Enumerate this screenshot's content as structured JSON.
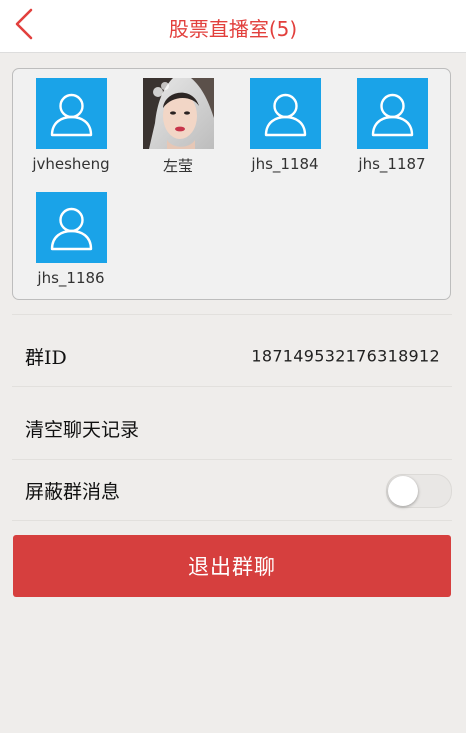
{
  "header": {
    "title": "股票直播室(5)",
    "back_icon": "chevron-left-icon",
    "accent_color": "#e2403d"
  },
  "members": [
    {
      "name": "jvhesheng",
      "avatar": "default-user-icon"
    },
    {
      "name": "左莹",
      "avatar": "user-photo"
    },
    {
      "name": "jhs_1184",
      "avatar": "default-user-icon"
    },
    {
      "name": "jhs_1187",
      "avatar": "default-user-icon"
    },
    {
      "name": "jhs_1186",
      "avatar": "default-user-icon"
    }
  ],
  "group_id": {
    "label": "群ID",
    "value": "187149532176318912"
  },
  "clear_history": {
    "label": "清空聊天记录"
  },
  "mute": {
    "label": "屏蔽群消息",
    "enabled": false
  },
  "quit_button": {
    "label": "退出群聊",
    "color": "#d63f3e"
  },
  "avatar_color": "#1aa3e8"
}
